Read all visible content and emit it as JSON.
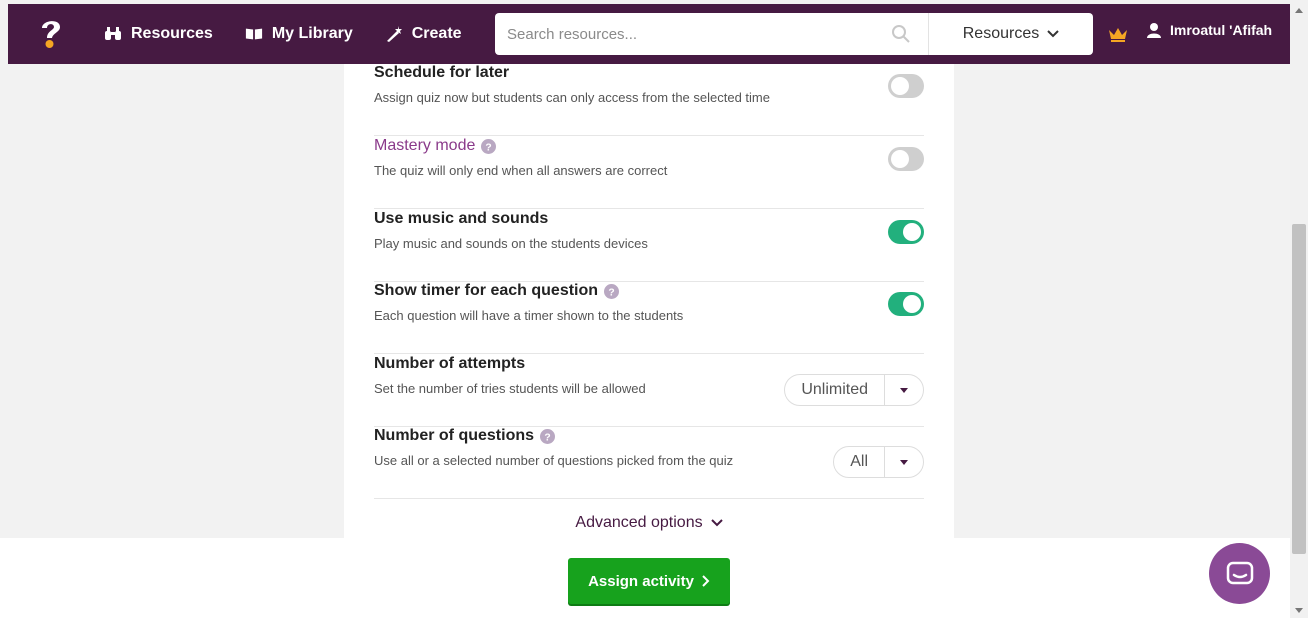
{
  "nav": {
    "resources_label": "Resources",
    "library_label": "My Library",
    "create_label": "Create",
    "search_placeholder": "Search resources...",
    "search_scope": "Resources",
    "user_name": "Imroatul 'Afifah"
  },
  "settings": [
    {
      "title": "Schedule for later",
      "desc": "Assign quiz now but students can only access from the selected time",
      "control": "toggle",
      "on": false
    },
    {
      "title": "Mastery mode",
      "desc": "The quiz will only end when all answers are correct",
      "control": "toggle",
      "on": false
    },
    {
      "title": "Use music and sounds",
      "desc": "Play music and sounds on the students devices",
      "control": "toggle",
      "on": true
    },
    {
      "title": "Show timer for each question",
      "desc": "Each question will have a timer shown to the students",
      "control": "toggle",
      "on": true
    },
    {
      "title": "Number of attempts",
      "desc": "Set the number of tries students will be allowed",
      "control": "dropdown",
      "value": "Unlimited"
    },
    {
      "title": "Number of questions",
      "desc": "Use all or a selected number of questions picked from the quiz",
      "control": "dropdown",
      "value": "All"
    }
  ],
  "advanced_label": "Advanced options",
  "assign_label": "Assign activity",
  "colors": {
    "brand": "#461a42",
    "toggle_on": "#22b07d",
    "toggle_off": "#cfcfcf",
    "assign_green": "#17a21d",
    "chat_purple": "#8a4a96",
    "mastery_purple": "#8a3a8a"
  },
  "icons": {
    "logo": "quizizz-logo-icon",
    "resources": "binoculars-icon",
    "library": "open-book-icon",
    "create": "magic-wand-icon",
    "search": "search-icon",
    "scope": "chevron-down-icon",
    "crown": "crown-icon",
    "user": "user-icon",
    "help": "question-circle-icon",
    "chat": "chat-bubble-icon"
  }
}
